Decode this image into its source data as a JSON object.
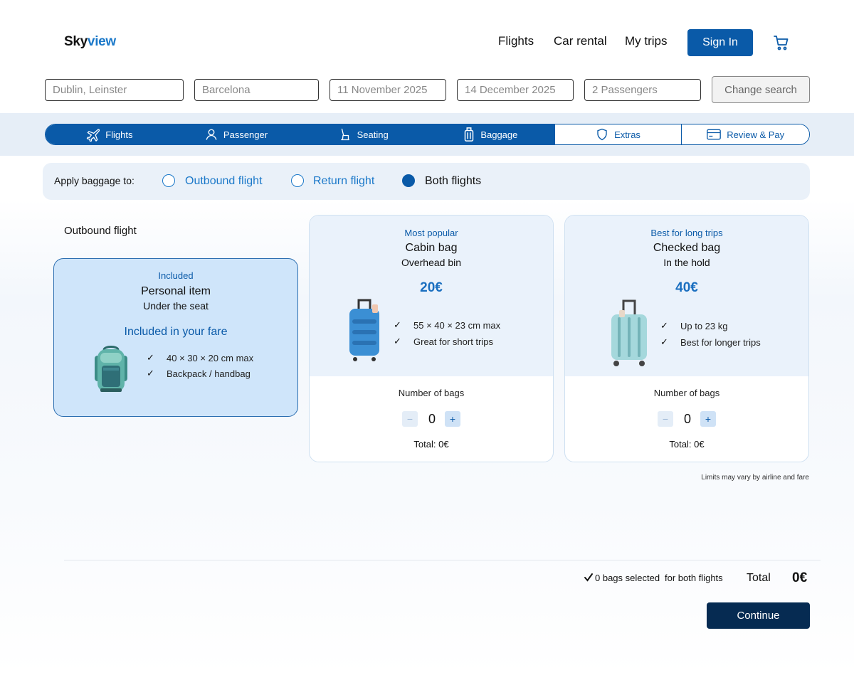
{
  "header": {
    "logo_part1": "Sky",
    "logo_part2": "view",
    "nav": [
      "Flights",
      "Car rental",
      "My trips"
    ],
    "sign_in": "Sign In",
    "cart_icon": "cart-icon"
  },
  "search": {
    "from": "Dublin, Leinster",
    "to": "Barcelona",
    "depart": "11 November 2025",
    "return": "14 December 2025",
    "passengers": "2 Passengers",
    "change_label": "Change search"
  },
  "steps": [
    {
      "label": "Flights",
      "icon": "plane-icon",
      "state": "done"
    },
    {
      "label": "Passenger",
      "icon": "person-icon",
      "state": "done"
    },
    {
      "label": "Seating",
      "icon": "seat-icon",
      "state": "done"
    },
    {
      "label": "Baggage",
      "icon": "luggage-icon",
      "state": "current"
    },
    {
      "label": "Extras",
      "icon": "shield-icon",
      "state": "todo"
    },
    {
      "label": "Review & Pay",
      "icon": "card-icon",
      "state": "todo"
    }
  ],
  "apply": {
    "label": "Apply baggage to:",
    "options": [
      {
        "label": "Outbound flight",
        "selected": false
      },
      {
        "label": "Return flight",
        "selected": false
      },
      {
        "label": "Both flights",
        "selected": true
      }
    ]
  },
  "section_title": "Outbound flight",
  "included": {
    "tag": "Included",
    "title": "Personal item",
    "subtitle": "Under the seat",
    "fare_note": "Included in your fare",
    "features": [
      "40 × 30 × 20 cm max",
      "Backpack / handbag"
    ]
  },
  "cabin": {
    "tag": "Most popular",
    "title": "Cabin bag",
    "subtitle": "Overhead bin",
    "price": "20€",
    "features": [
      "55 × 40 × 23 cm max",
      "Great for short trips"
    ],
    "count_label": "Number of bags",
    "qty": "0",
    "total": "Total: 0€"
  },
  "checked": {
    "tag": "Best for long trips",
    "title": "Checked bag",
    "subtitle": "In the hold",
    "price": "40€",
    "features": [
      "Up to 23 kg",
      "Best for longer trips"
    ],
    "count_label": "Number of bags",
    "qty": "0",
    "total": "Total: 0€"
  },
  "stepper": {
    "minus": "−",
    "plus": "+"
  },
  "note": "Limits may vary by airline and fare",
  "summary": {
    "bags": "0 bags selected",
    "scope": "for both flights",
    "total_label": "Total",
    "total_value": "0€"
  },
  "continue_label": "Continue",
  "colors": {
    "primary": "#0a5aa8",
    "accent": "#1a78c9",
    "dark": "#062b52",
    "card_bg": "#cfe5fa"
  }
}
